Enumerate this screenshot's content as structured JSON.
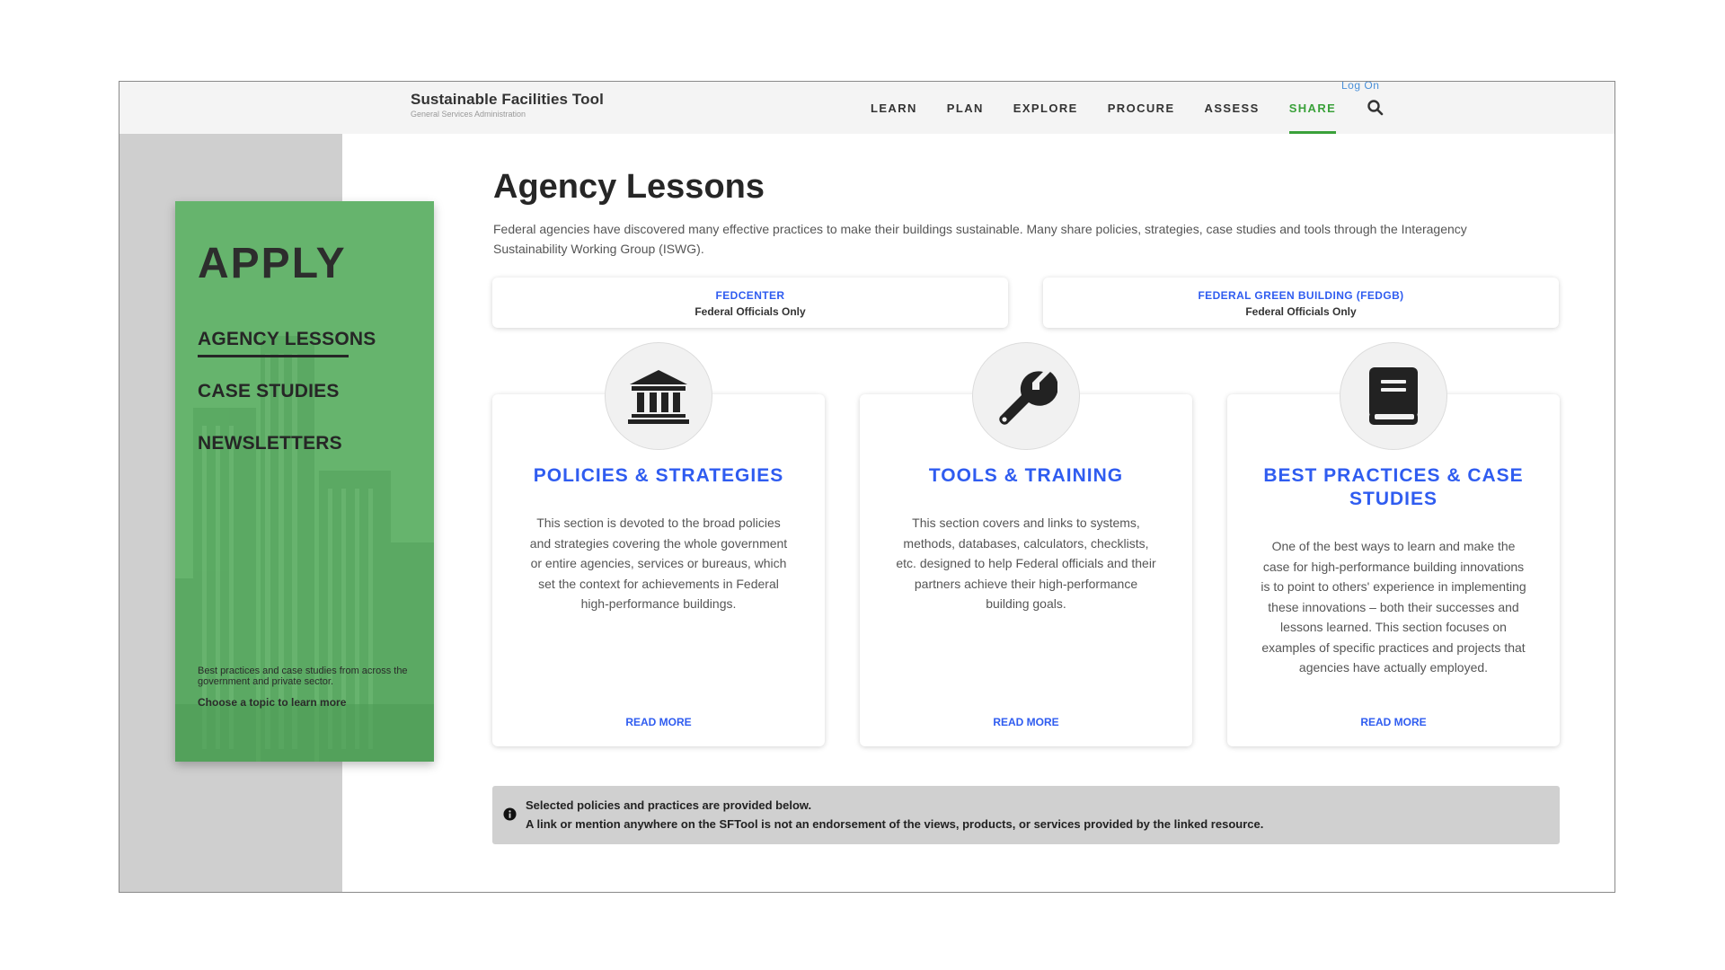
{
  "header": {
    "brand_title": "Sustainable Facilities Tool",
    "brand_subtitle": "General Services Administration",
    "logon": "Log On",
    "nav": [
      "LEARN",
      "PLAN",
      "EXPLORE",
      "PROCURE",
      "ASSESS",
      "SHARE"
    ],
    "active_nav": "SHARE",
    "search_icon": "search-icon"
  },
  "sidebar": {
    "title": "APPLY",
    "links": [
      "AGENCY LESSONS",
      "CASE STUDIES",
      "NEWSLETTERS"
    ],
    "active_link": "AGENCY LESSONS",
    "note": "Best practices and case studies from across the government and private sector.",
    "cta": "Choose a topic to learn more"
  },
  "main": {
    "title": "Agency Lessons",
    "intro": "Federal agencies have discovered many effective practices to make their buildings sustainable. Many share policies, strategies, case studies and tools through the Interagency Sustainability Working Group (ISWG).",
    "wide_cards": [
      {
        "title": "FEDCENTER",
        "subtitle": "Federal Officials Only"
      },
      {
        "title": "FEDERAL GREEN BUILDING (FEDGB)",
        "subtitle": "Federal Officials Only"
      }
    ],
    "features": [
      {
        "icon": "building-columns-icon",
        "title": "POLICIES & STRATEGIES",
        "body": "This section is devoted to the broad policies and strategies covering the whole government or entire agencies, services or bureaus, which set the context for achievements in Federal high-performance buildings.",
        "link": "READ MORE"
      },
      {
        "icon": "wrench-icon",
        "title": "TOOLS & TRAINING",
        "body": "This section covers and links to systems, methods, databases, calculators, checklists, etc. designed to help Federal officials and their partners achieve their high-performance building goals.",
        "link": "READ MORE"
      },
      {
        "icon": "book-icon",
        "title": "BEST PRACTICES & CASE STUDIES",
        "body": "One of the best ways to learn and make the case for high-performance building innovations is to point to others' experience in implementing these innovations – both their successes and lessons learned. This section focuses on examples of specific practices and projects that agencies have actually employed.",
        "link": "READ MORE"
      }
    ],
    "notice": {
      "line1": "Selected policies and practices are provided below.",
      "line2": "A link or mention anywhere on the SFTool is not an endorsement of the views, products, or services provided by the linked resource."
    }
  },
  "colors": {
    "accent_green": "#3aa13a",
    "panel_green": "#66b46d",
    "link_blue": "#2f5cf0",
    "notice_gray": "#d0d0d0"
  }
}
